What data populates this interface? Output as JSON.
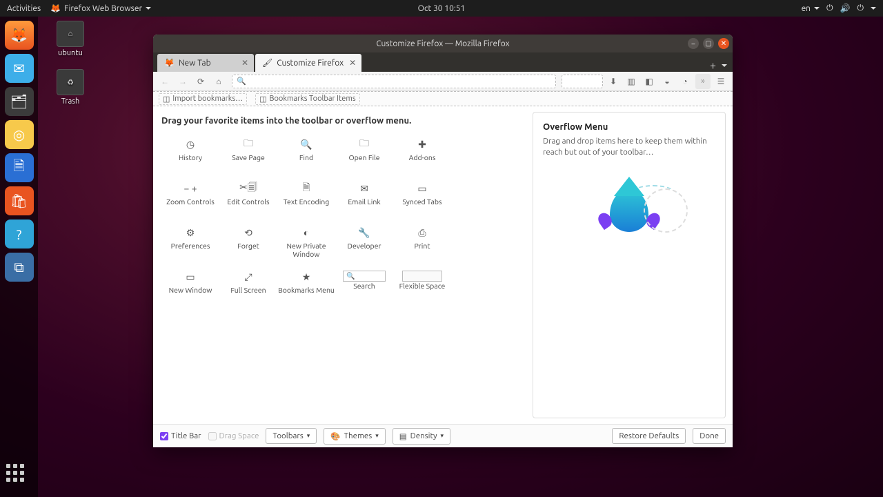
{
  "topbar": {
    "activities": "Activities",
    "app": "Firefox Web Browser",
    "clock": "Oct 30 10:51",
    "lang": "en"
  },
  "desktop_icons": [
    {
      "name": "ubuntu",
      "glyph": "⌂"
    },
    {
      "name": "Trash",
      "glyph": "♻"
    }
  ],
  "window": {
    "title": "Customize Firefox — Mozilla Firefox",
    "tabs": [
      {
        "label": "New Tab",
        "active": false
      },
      {
        "label": "Customize Firefox",
        "active": true
      }
    ],
    "bookmarks_bar": {
      "import": "Import bookmarks…",
      "items": "Bookmarks Toolbar Items"
    }
  },
  "palette": {
    "title": "Drag your favorite items into the toolbar or overflow menu.",
    "items": [
      {
        "label": "History",
        "glyph": "◷"
      },
      {
        "label": "Save Page",
        "glyph": "🗀"
      },
      {
        "label": "Find",
        "glyph": "🔍"
      },
      {
        "label": "Open File",
        "glyph": "🗀"
      },
      {
        "label": "Add-ons",
        "glyph": "✚"
      },
      {
        "label": "Zoom Controls",
        "glyph": "− +"
      },
      {
        "label": "Edit Controls",
        "glyph": "✂🗐"
      },
      {
        "label": "Text Encoding",
        "glyph": "🗎"
      },
      {
        "label": "Email Link",
        "glyph": "✉"
      },
      {
        "label": "Synced Tabs",
        "glyph": "▭"
      },
      {
        "label": "Preferences",
        "glyph": "⚙"
      },
      {
        "label": "Forget",
        "glyph": "⟲"
      },
      {
        "label": "New Private Window",
        "glyph": "◐"
      },
      {
        "label": "Developer",
        "glyph": "🔧"
      },
      {
        "label": "Print",
        "glyph": "⎙"
      },
      {
        "label": "New Window",
        "glyph": "▭"
      },
      {
        "label": "Full Screen",
        "glyph": "⤢"
      },
      {
        "label": "Bookmarks Menu",
        "glyph": "★"
      },
      {
        "label": "Search",
        "glyph": "",
        "kind": "search"
      },
      {
        "label": "Flexible Space",
        "glyph": "",
        "kind": "flex"
      }
    ]
  },
  "overflow": {
    "heading": "Overflow Menu",
    "desc": "Drag and drop items here to keep them within reach but out of your toolbar…"
  },
  "footer": {
    "titlebar": "Title Bar",
    "dragspace": "Drag Space",
    "toolbars": "Toolbars",
    "themes": "Themes",
    "density": "Density",
    "restore": "Restore Defaults",
    "done": "Done"
  }
}
